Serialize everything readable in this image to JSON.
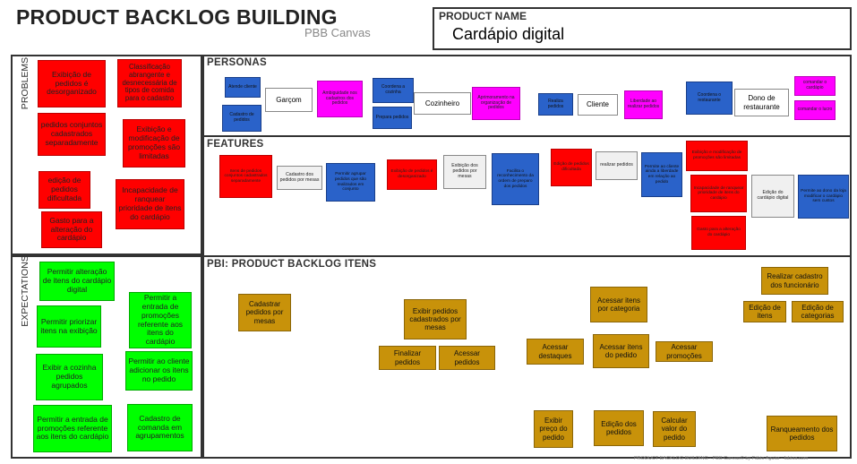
{
  "header": {
    "title": "PRODUCT BACKLOG BUILDING",
    "subtitle": "PBB Canvas",
    "product_name_label": "PRODUCT NAME",
    "product_name_value": "Cardápio digital"
  },
  "sections": {
    "problems": "PROBLEMS",
    "expectations": "EXPECTATIONS",
    "personas": "PERSONAS",
    "features": "FEATURES",
    "pbi": "PBI: PRODUCT BACKLOG ITENS"
  },
  "problems": [
    "Exibição de pedidos é desorganizado",
    "Classificação abrangente e desnecessária de tipos de comida para o cadastro",
    "pedidos conjuntos cadastrados separadamente",
    "Exibição e modificação de promoções são limitadas",
    "edição de pedidos dificultada",
    "Incapacidade de ranquear prioridade de itens do cardápio",
    "Gasto para a alteração do cardápio"
  ],
  "expectations": [
    "Permitir alteração de itens do cardápio digital",
    "Permitir a entrada de promoções referente aos itens do cardápio",
    "Permitir priorizar itens na exibição",
    "Exibir a cozinha pedidos agrupados",
    "Permitir ao cliente adicionar os itens no pedido",
    "Permitir a entrada de promoções referente aos itens do cardápio",
    "Cadastro de comanda em agrupamentos"
  ],
  "personas": {
    "garcom": {
      "name": "Garçom",
      "blue": [
        "Atende cliente",
        "Cadastro de pedidos"
      ],
      "magenta": "Ambiguidade nos cadastros dos pedidos"
    },
    "cozinheiro": {
      "name": "Cozinheiro",
      "blue": [
        "Coordena a cozinha",
        "Prepara pedidos"
      ],
      "magenta": "Aprimoramento na organização de pedidos"
    },
    "cliente": {
      "name": "Cliente",
      "blue": [
        "Realiza pedidos"
      ],
      "magenta": "Liberdade ao realizar pedidos"
    },
    "dono": {
      "name": "Dono de restaurante",
      "blue": [
        "Coordena o restaurante"
      ],
      "magenta": [
        "comandar o cardápio",
        "comandar o lucro"
      ]
    }
  },
  "features": [
    "Itens de pedidos conjuntos cadastrados separadamente",
    "Cadastro dos pedidos por mesas",
    "Permitir agrupar pedidos que são realizados em conjunto",
    "Exibição de pedidos é desorganizado",
    "Exibição dos pedidos por mesas",
    "Facilita o reconhecimento da ordem de preparo dos pedidos",
    "Edição de pedidos dificultada",
    "realizar pedidos",
    "Permite ao cliente ainda a liberdade em relação ao pedido",
    "Exibição e modificação de promoções são limitadas",
    "Incapacidade de ranquear prioridade de itens do cardápio",
    "Gasto para a alteração do cardápio",
    "Edição do cardápio digital",
    "Permite ao dono da loja modificar o cardápio sem custos"
  ],
  "pbi": [
    "Cadastrar pedidos por mesas",
    "Exibir pedidos cadastrados por mesas",
    "Finalizar pedidos",
    "Acessar pedidos",
    "Acessar itens por categoria",
    "Acessar destaques",
    "Acessar itens do pedido",
    "Acessar promoções",
    "Exibir preço do pedido",
    "Edição dos pedidos",
    "Calcular valor do pedido",
    "Realizar cadastro dos funcionário",
    "Edição de itens",
    "Edição de categorias",
    "Ranqueamento dos pedidos"
  ],
  "footer": "PRODUCT BACKLOG BUILDING - PBB Canvas© by Fábio Aguiar - fabioa.com"
}
